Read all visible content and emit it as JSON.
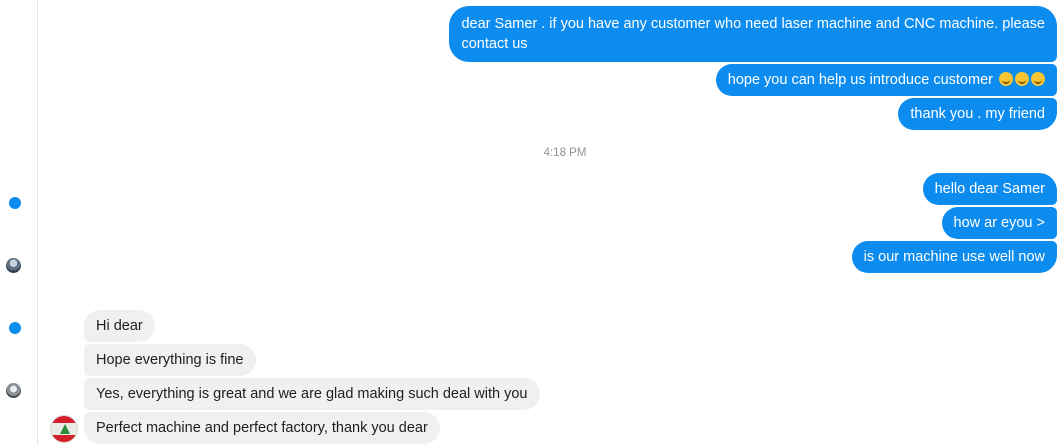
{
  "conversation": {
    "outgoing_group_1": [
      {
        "line1": "dear Samer . if you have any customer who need laser machine and CNC machine. please",
        "line2": "contact us"
      },
      {
        "text": "hope you can help us introduce customer"
      },
      {
        "text": "thank you . my friend"
      }
    ],
    "emoji_icon": "smiling-face-emoji",
    "timestamp": "4:18 PM",
    "outgoing_group_2": [
      {
        "text": "hello dear Samer"
      },
      {
        "text": "how ar eyou >"
      },
      {
        "text": "is our machine use well now"
      }
    ],
    "incoming_group": [
      {
        "text": "Hi dear"
      },
      {
        "text": "Hope everything is fine"
      },
      {
        "text": "Yes, everything is great and we are glad making such deal with you"
      },
      {
        "text": "Perfect machine and perfect factory, thank you dear"
      }
    ]
  },
  "colors": {
    "outgoing_bubble": "#0d8cf0",
    "incoming_bubble": "#f1f0f0",
    "unread_dot": "#0d8cf0"
  }
}
